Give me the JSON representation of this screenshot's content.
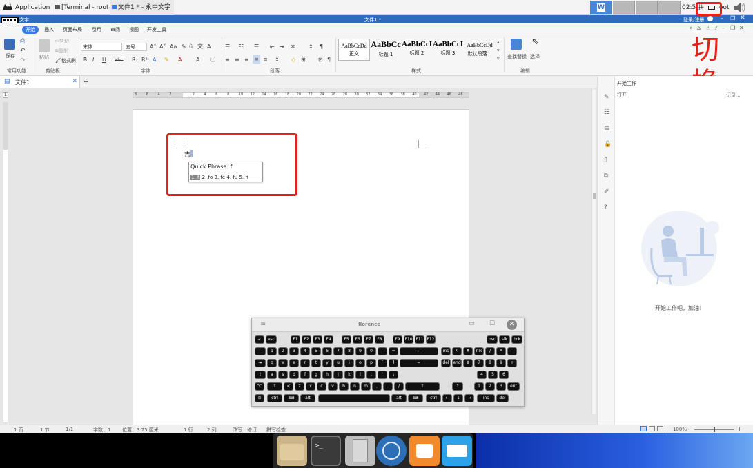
{
  "topbar": {
    "applications": "Applications",
    "task_terminal": "[Terminal - root...",
    "task_writer": "文件1 * - 永中文字",
    "clock": "02:5",
    "ime_label": "拼",
    "user": "oot"
  },
  "titlebar": {
    "left": "文字",
    "center": "文件1 *",
    "login": "登录/注册"
  },
  "ribbon_tabs": [
    "开始",
    "插入",
    "页面布局",
    "引用",
    "审阅",
    "视图",
    "开发工具"
  ],
  "ribbon": {
    "save": "保存",
    "paste": "粘贴",
    "cut": "剪切",
    "copy": "复制",
    "format_painter": "格式刷",
    "font_name": "宋体",
    "font_size": "五号",
    "find_replace": "查找替换",
    "select": "选择",
    "groups": [
      "常用功能",
      "剪贴板",
      "字体",
      "段落",
      "样式",
      "编辑"
    ],
    "styles": [
      {
        "preview": "AaBbCcDd",
        "name": "正文"
      },
      {
        "preview": "AaBbCc",
        "name": "标题 1"
      },
      {
        "preview": "AaBbCcI",
        "name": "标题 2"
      },
      {
        "preview": "AaBbCcI",
        "name": "标题 3"
      },
      {
        "preview": "AaBbCcDd",
        "name": "默认段落..."
      }
    ]
  },
  "doctab": "文件1",
  "ruler_ticks": [
    "8",
    "6",
    "4",
    "2",
    "",
    "2",
    "4",
    "6",
    "8",
    "10",
    "12",
    "14",
    "16",
    "18",
    "20",
    "22",
    "24",
    "26",
    "28",
    "30",
    "32",
    "34",
    "36",
    "38",
    "40",
    "42",
    "44",
    "46",
    "48"
  ],
  "document": {
    "typed": "吉"
  },
  "quick_phrase": {
    "label": "Quick Phrase: f",
    "candidates": [
      "1. f",
      "2. fo",
      "3. fe",
      "4. fu",
      "5. fi"
    ]
  },
  "right_panel": {
    "title": "开始工作",
    "open": "打开",
    "recent_hint": "记录...",
    "encourage": "开始工作吧，加油！"
  },
  "annotation": {
    "switch_text": "切换"
  },
  "statusbar": {
    "page": "1 页",
    "section": "1 节",
    "pages": "1/1",
    "chars": "字数：1",
    "position": "位置：3.75 厘米",
    "line": "1 行",
    "col": "2 列",
    "overwrite": "改写",
    "revise": "修订",
    "spell": "拼写检查",
    "zoom": "100%"
  },
  "florence": {
    "title": "florence",
    "rows": [
      [
        "esc",
        "F1",
        "F2",
        "F3",
        "F4",
        "F5",
        "F6",
        "F7",
        "F8",
        "F9",
        "F10",
        "F11",
        "F12",
        "psc",
        "slk",
        "brk"
      ],
      [
        "`",
        "1",
        "2",
        "3",
        "4",
        "5",
        "6",
        "7",
        "8",
        "9",
        "0",
        "-",
        "=",
        "←",
        "ins",
        "↖",
        "⇞",
        "nlk",
        "/",
        "*",
        "-"
      ],
      [
        "⇥",
        "q",
        "w",
        "e",
        "r",
        "t",
        "y",
        "u",
        "i",
        "o",
        "p",
        "[",
        "]",
        "↵",
        "del",
        "end",
        "⇟",
        "7",
        "8",
        "9",
        "+"
      ],
      [
        "⇪",
        "a",
        "s",
        "d",
        "f",
        "g",
        "h",
        "j",
        "k",
        "l",
        ";",
        "'",
        "\\",
        "4",
        "5",
        "6"
      ],
      [
        "⇧",
        "<",
        "z",
        "x",
        "c",
        "v",
        "b",
        "n",
        "m",
        ",",
        ".",
        "/",
        "⇧",
        "↑",
        "1",
        "2",
        "3",
        "ent"
      ],
      [
        "ctrl",
        "⌨",
        "alt",
        "",
        "alt",
        "⌨",
        "ctrl",
        "←",
        "↓",
        "→",
        "ins",
        "del"
      ]
    ]
  },
  "colors": {
    "titlebar": "#2e6bbd",
    "highlight": "#e8201a",
    "accent": "#3a7be0"
  }
}
